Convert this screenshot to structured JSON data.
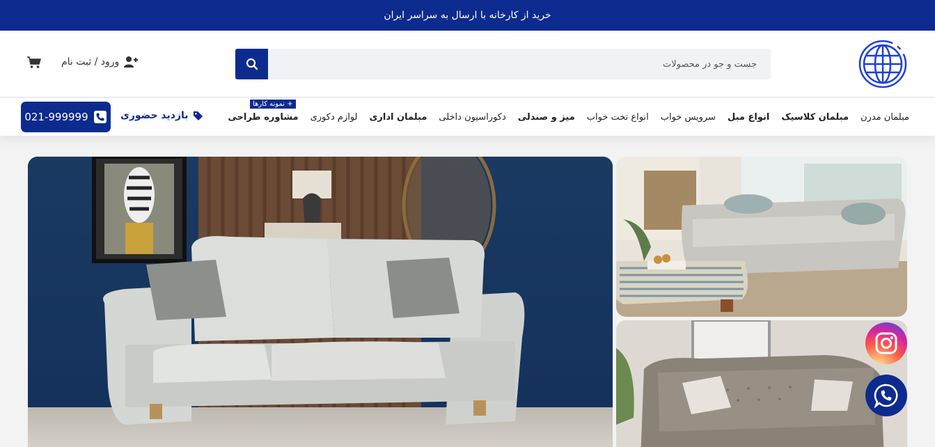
{
  "topbar": {
    "text": "خرید از کارخانه با ارسال به سراسر ایران"
  },
  "header": {
    "search_placeholder": "جست و جو در محصولات",
    "login_label": "ورود / ثبت نام"
  },
  "nav": {
    "items": [
      {
        "label": "مبلمان مدرن",
        "bold": false
      },
      {
        "label": "مبلمان کلاسیک",
        "bold": true
      },
      {
        "label": "انواع مبل",
        "bold": true
      },
      {
        "label": "سرویس خواب",
        "bold": false
      },
      {
        "label": "انواع تخت خواب",
        "bold": false
      },
      {
        "label": "میز و صندلی",
        "bold": true
      },
      {
        "label": "دکوراسیون داخلی",
        "bold": false
      },
      {
        "label": "مبلمان اداری",
        "bold": true
      },
      {
        "label": "لوازم دکوری",
        "bold": false
      },
      {
        "label": "مشاوره طراحی",
        "bold": true
      }
    ],
    "badge": "+ نمونه کارها",
    "visit_label": "بازدید حضوری",
    "phone": "021-999999"
  },
  "social": {
    "instagram": "instagram-icon",
    "whatsapp": "whatsapp-icon"
  },
  "colors": {
    "brand": "#0d2b8e",
    "background": "#f3f3f3"
  }
}
